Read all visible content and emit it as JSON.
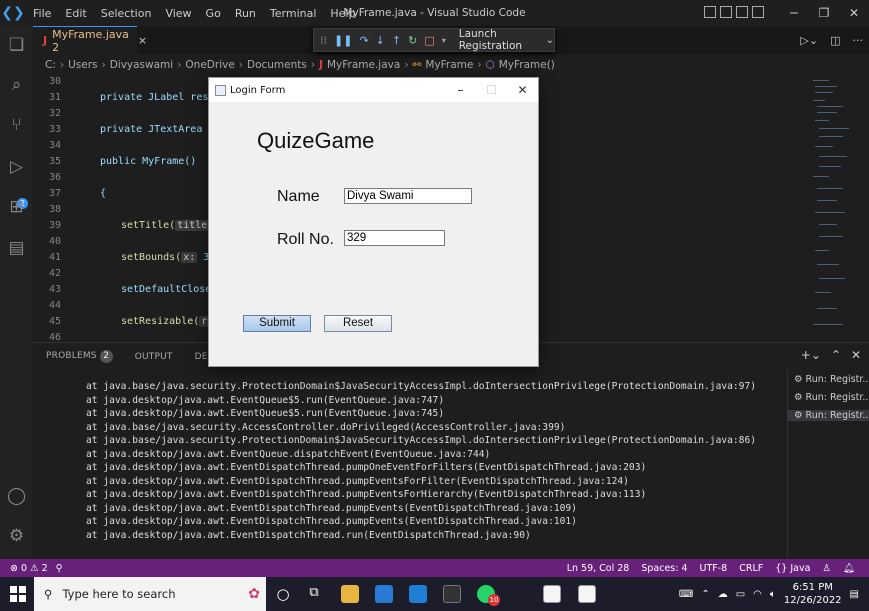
{
  "window": {
    "title": "MyFrame.java - Visual Studio Code"
  },
  "menu": [
    "File",
    "Edit",
    "Selection",
    "View",
    "Go",
    "Run",
    "Terminal",
    "Help"
  ],
  "tab": {
    "icon": "J",
    "name": "MyFrame.java 2",
    "close": "×"
  },
  "debug": {
    "config": "Launch Registration"
  },
  "breadcrumb": [
    "C:",
    "Users",
    "Divyaswami",
    "OneDrive",
    "Documents",
    "MyFrame.java",
    "MyFrame",
    "MyFrame()"
  ],
  "editor": {
    "lines": [
      {
        "n": "30",
        "t": ""
      },
      {
        "n": "31",
        "t": "private JLabel res;"
      },
      {
        "n": "32",
        "t": ""
      },
      {
        "n": "33",
        "t": "private JTextArea res"
      },
      {
        "n": "34",
        "t": ""
      },
      {
        "n": "35",
        "t": "public MyFrame()"
      },
      {
        "n": "36",
        "t": ""
      },
      {
        "n": "37",
        "t": "{"
      },
      {
        "n": "38",
        "t": ""
      },
      {
        "n": "39",
        "t": "setTitle("
      },
      {
        "n": "40",
        "t": ""
      },
      {
        "n": "41",
        "t": "setBounds("
      },
      {
        "n": "42",
        "t": ""
      },
      {
        "n": "43",
        "t": "setDefaultCloseOp"
      },
      {
        "n": "44",
        "t": ""
      },
      {
        "n": "45",
        "t": "setResizable("
      },
      {
        "n": "46",
        "t": ""
      }
    ],
    "hint_title": "title:",
    "hint_title_tail": " \"",
    "hint_x": "x:",
    "hint_x_tail": " 300,",
    "hint_resi": "resi"
  },
  "panel": {
    "tabs": [
      "PROBLEMS",
      "OUTPUT",
      "DEBUG CONSO"
    ],
    "problems_count": "2",
    "terminal_lines": [
      "at java.base/java.security.ProtectionDomain$JavaSecurityAccessImpl.doIntersectionPrivilege(ProtectionDomain.java:97)",
      "at java.desktop/java.awt.EventQueue$5.run(EventQueue.java:747)",
      "at java.desktop/java.awt.EventQueue$5.run(EventQueue.java:745)",
      "at java.base/java.security.AccessController.doPrivileged(AccessController.java:399)",
      "at java.base/java.security.ProtectionDomain$JavaSecurityAccessImpl.doIntersectionPrivilege(ProtectionDomain.java:86)",
      "at java.desktop/java.awt.EventQueue.dispatchEvent(EventQueue.java:744)",
      "at java.desktop/java.awt.EventDispatchThread.pumpOneEventForFilters(EventDispatchThread.java:203)",
      "at java.desktop/java.awt.EventDispatchThread.pumpEventsForFilter(EventDispatchThread.java:124)",
      "at java.desktop/java.awt.EventDispatchThread.pumpEventsForHierarchy(EventDispatchThread.java:113)",
      "at java.desktop/java.awt.EventDispatchThread.pumpEvents(EventDispatchThread.java:109)",
      "at java.desktop/java.awt.EventDispatchThread.pumpEvents(EventDispatchThread.java:101)",
      "at java.desktop/java.awt.EventDispatchThread.run(EventDispatchThread.java:90)"
    ],
    "terminals": [
      "Run: Registr...",
      "Run: Registr...",
      "Run: Registr..."
    ]
  },
  "status": {
    "errors": "0",
    "warnings": "2",
    "position": "Ln 59, Col 28",
    "spaces": "Spaces: 4",
    "encoding": "UTF-8",
    "eol": "CRLF",
    "language": "{} Java"
  },
  "dialog": {
    "title": "Login Form",
    "heading": "QuizeGame",
    "name_label": "Name",
    "name_value": "Divya Swami",
    "roll_label": "Roll No.",
    "roll_value": "329",
    "submit": "Submit",
    "reset": "Reset"
  },
  "taskbar": {
    "search_placeholder": "Type here to search",
    "time": "6:51 PM",
    "date": "12/26/2022",
    "whatsapp_badge": "10"
  },
  "colors": {
    "accent": "#3794ff",
    "statusbar": "#68217a"
  }
}
